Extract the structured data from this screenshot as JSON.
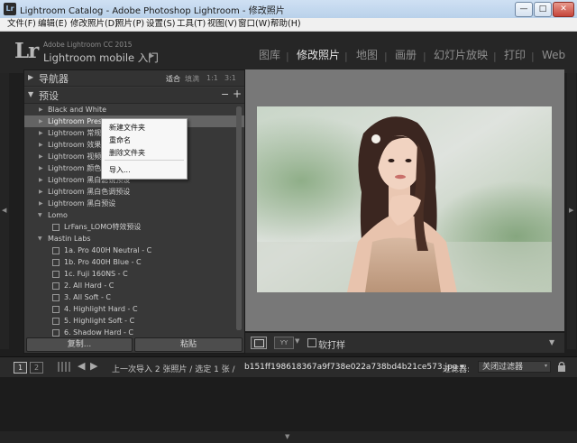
{
  "window": {
    "title": "Lightroom Catalog - Adobe Photoshop Lightroom - 修改照片",
    "minimize_glyph": "—",
    "maximize_glyph": "□",
    "close_glyph": "✕"
  },
  "menubar": [
    "文件(F)",
    "编辑(E)",
    "修改照片(D)",
    "照片(P)",
    "设置(S)",
    "工具(T)",
    "视图(V)",
    "窗口(W)",
    "帮助(H)"
  ],
  "header": {
    "logo": "Lr",
    "brand_line1": "Adobe Lightroom CC 2015",
    "brand_line2": "Lightroom mobile 入门",
    "brand_arrow": "▶",
    "modules": [
      "图库",
      "修改照片",
      "地图",
      "画册",
      "幻灯片放映",
      "打印",
      "Web"
    ],
    "active_module": "修改照片",
    "separator": "|"
  },
  "left_panel": {
    "navigator": {
      "title": "导航器",
      "options": [
        "适合",
        "填满",
        "1:1",
        "3:1"
      ],
      "active_option": "适合"
    },
    "presets": {
      "title": "预设",
      "minus": "−",
      "plus": "+",
      "items": [
        "Black and White",
        "Lightroom Presets",
        "Lightroom 常规预设",
        "Lightroom 效果预设",
        "Lightroom 视频预设",
        "Lightroom 颜色预设",
        "Lightroom 黑白滤镜预设",
        "Lightroom 黑白色调预设",
        "Lightroom 黑白预设",
        "Lomo",
        "LrFans_LOMO特效预设",
        "Mastin Labs",
        "1a. Pro 400H Neutral - C",
        "1b. Pro 400H Blue - C",
        "1c. Fuji 160NS - C",
        "2. All Hard - C",
        "3. All Soft - C",
        "4. Highlight Hard - C",
        "5. Highlight Soft - C",
        "6. Shadow Hard - C"
      ]
    },
    "buttons": {
      "copy": "复制...",
      "paste": "粘贴"
    }
  },
  "context_menu": {
    "items": [
      "新建文件夹",
      "重命名",
      "删除文件夹",
      "导入..."
    ]
  },
  "toolbar": {
    "view_yy": "YY",
    "soft_proof_label": "软打样",
    "dropdown_glyph": "▼"
  },
  "filmstrip": {
    "screen1": "1",
    "screen2": "2",
    "back_glyph": "◀",
    "forward_glyph": "▶",
    "path_text": "上一次导入  2 张照片 / 选定 1 张 /",
    "filename": "b151ff198618367a9f738e022a738bd4b21ce573.jpg",
    "filename_suffix": "▾",
    "filter_label": "过滤器:",
    "filter_value": "关闭过滤器",
    "filter_arrow": "▾"
  },
  "colors": {
    "background": "#1e1e1e",
    "panel": "#383838",
    "main_area": "#787878",
    "selected_row": "#646464",
    "active_module": "#e6e6e6"
  },
  "icons": {
    "collapse": "triangle-down-icon",
    "expand": "triangle-right-icon",
    "preset": "preset-file-icon",
    "lock": "lock-icon"
  }
}
